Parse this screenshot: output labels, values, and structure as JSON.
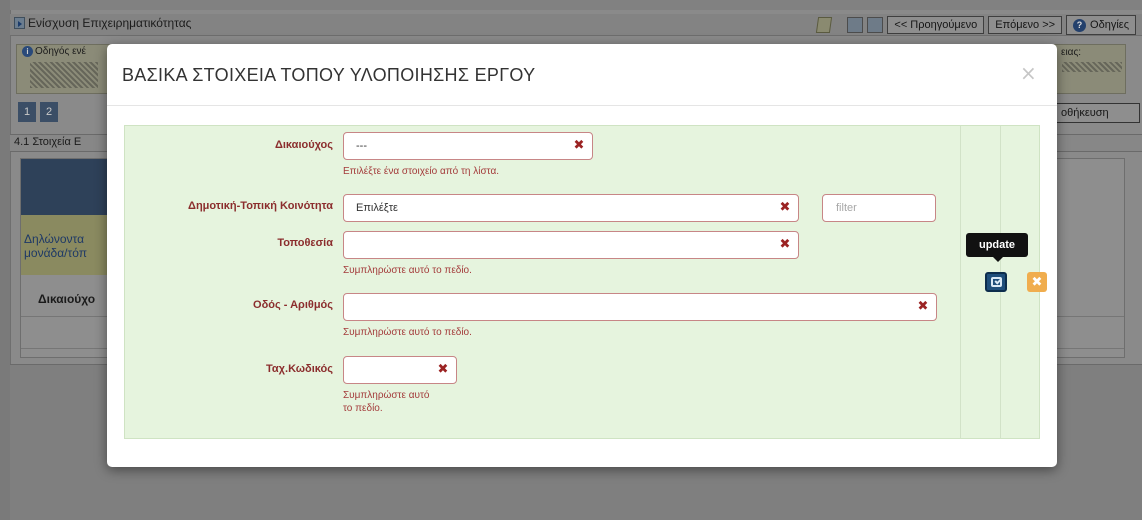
{
  "app": {
    "title": "Ενίσχυση Επιχειρηματικότητας",
    "toolbar": {
      "prev_label": "<< Προηγούμενο",
      "next_label": "Επόμενο >>",
      "help_label": "Οδηγίες"
    },
    "info": {
      "guide_text": "Οδηγός ενέ",
      "right_text": "ειας:"
    },
    "steps": [
      "1",
      "2"
    ],
    "save_label": "οθήκευση",
    "section_label": "4.1 Στοιχεία Ε",
    "bg_declare_text_1": "Δηλώνοντα",
    "bg_declare_text_2": "μονάδα/τόπ",
    "bg_column_header": "Δικαιούχο"
  },
  "modal": {
    "title": "ΒΑΣΙΚΑ ΣΤΟΙΧΕΙΑ ΤΟΠΟΥ ΥΛΟΠΟΙΗΣΗΣ ΕΡΓΟΥ",
    "close_glyph": "×",
    "fields": {
      "beneficiary": {
        "label": "Δικαιούχος",
        "value": "---",
        "hint": "Επιλέξτε ένα στοιχείο από τη λίστα."
      },
      "community": {
        "label": "Δημοτική-Τοπική Κοινότητα",
        "value": "Επιλέξτε",
        "filter_placeholder": "filter"
      },
      "location": {
        "label": "Τοποθεσία",
        "value": "",
        "hint": "Συμπληρώστε αυτό το πεδίο."
      },
      "street": {
        "label": "Οδός - Αριθμός",
        "value": "",
        "hint": "Συμπληρώστε αυτό το πεδίο."
      },
      "postal_code": {
        "label": "Ταχ.Κωδικός",
        "value": "",
        "hint_line_1": "Συμπληρώστε αυτό",
        "hint_line_2": "το πεδίο."
      }
    },
    "clear_glyph": "✖",
    "tooltip": "update",
    "cancel_glyph": "✖",
    "colors": {
      "panel_bg": "#e6f4de",
      "label": "#8b2d2d",
      "input_border": "#c78686",
      "update_btn": "#1f4e7b",
      "cancel_btn": "#f0ad4e"
    }
  }
}
